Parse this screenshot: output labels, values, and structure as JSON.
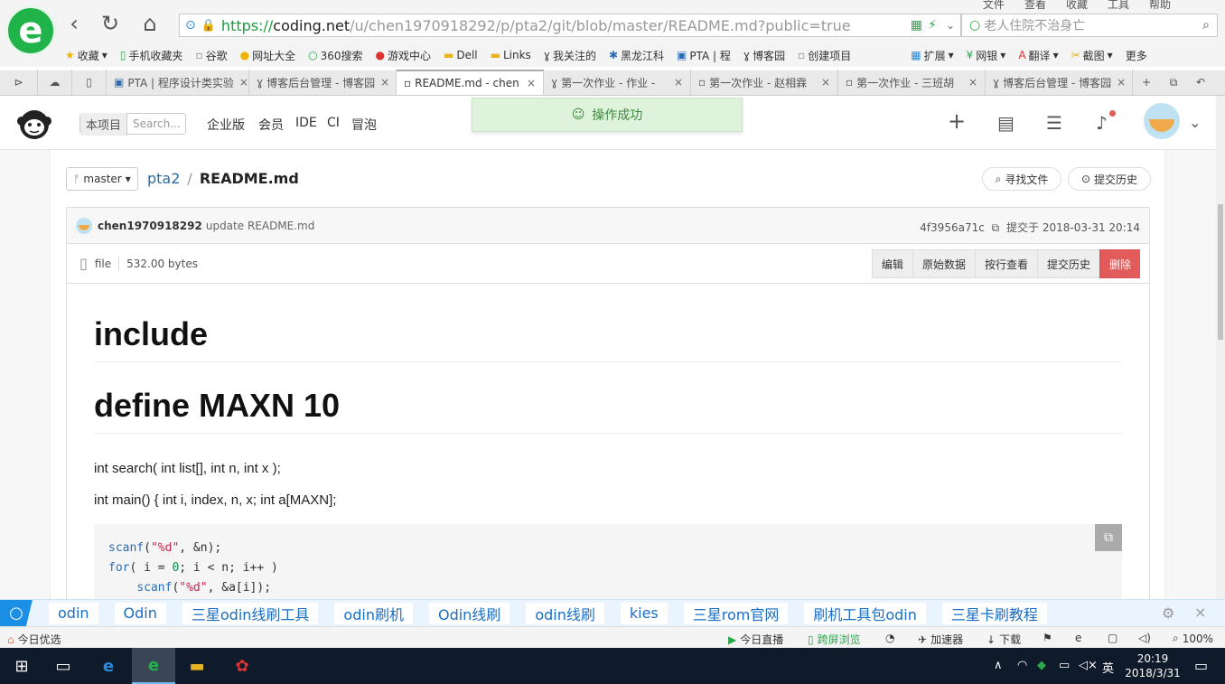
{
  "browser": {
    "url_prefix": "https://",
    "url_host": "coding.net",
    "url_path": "/u/chen1970918292/p/pta2/git/blob/master/README.md?public=true",
    "search_placeholder": "老人住院不治身亡",
    "menu": [
      "文件",
      "查看",
      "收藏",
      "工具",
      "帮助"
    ],
    "bookmarks": [
      "收藏",
      "手机收藏夹",
      "谷歌",
      "网址大全",
      "360搜索",
      "游戏中心",
      "Dell",
      "Links",
      "我关注的",
      "黑龙江科",
      "PTA | 程",
      "博客园",
      "创建项目",
      "扩展",
      "网银",
      "翻译",
      "截图",
      "更多"
    ],
    "tabs": [
      {
        "title": "PTA | 程序设计类实验"
      },
      {
        "title": "博客后台管理 - 博客园"
      },
      {
        "title": "README.md - chen"
      },
      {
        "title": "第一次作业 - 作业 -"
      },
      {
        "title": "第一次作业 - 赵相霖"
      },
      {
        "title": "第一次作业 - 三班胡"
      },
      {
        "title": "博客后台管理 - 博客园"
      }
    ]
  },
  "app": {
    "scope_label": "本项目",
    "search_placeholder": "Search...",
    "nav": [
      "企业版",
      "会员",
      "IDE",
      "CI",
      "冒泡"
    ],
    "toast": "操作成功"
  },
  "repo": {
    "branch": "master",
    "name": "pta2",
    "file": "README.md",
    "find_file": "寻找文件",
    "history": "提交历史",
    "commit_author": "chen1970918292",
    "commit_msg": "update README.md",
    "commit_hash": "4f3956a71c",
    "commit_time": "提交于 2018-03-31 20:14",
    "file_label": "file",
    "file_size": "532.00 bytes",
    "actions": [
      "编辑",
      "原始数据",
      "按行查看",
      "提交历史",
      "删除"
    ]
  },
  "readme": {
    "h1_a": "include",
    "h1_b": "define MAXN 10",
    "p1": "int search( int list[], int n, int x );",
    "p2": "int main() { int i, index, n, x; int a[MAXN];"
  },
  "adbar": {
    "links": [
      "odin",
      "Odin",
      "三星odin线刷工具",
      "odin刷机",
      "Odin线刷",
      "odin线刷",
      "kies",
      "三星rom官网",
      "刷机工具包odin",
      "三星卡刷教程"
    ]
  },
  "statusbar": {
    "left": "今日优选",
    "live": "今日直播",
    "cross": "跨屏浏览",
    "accel": "加速器",
    "download": "下载",
    "zoom": "100%"
  },
  "taskbar": {
    "time": "20:19",
    "date": "2018/3/31",
    "ime": "英"
  }
}
